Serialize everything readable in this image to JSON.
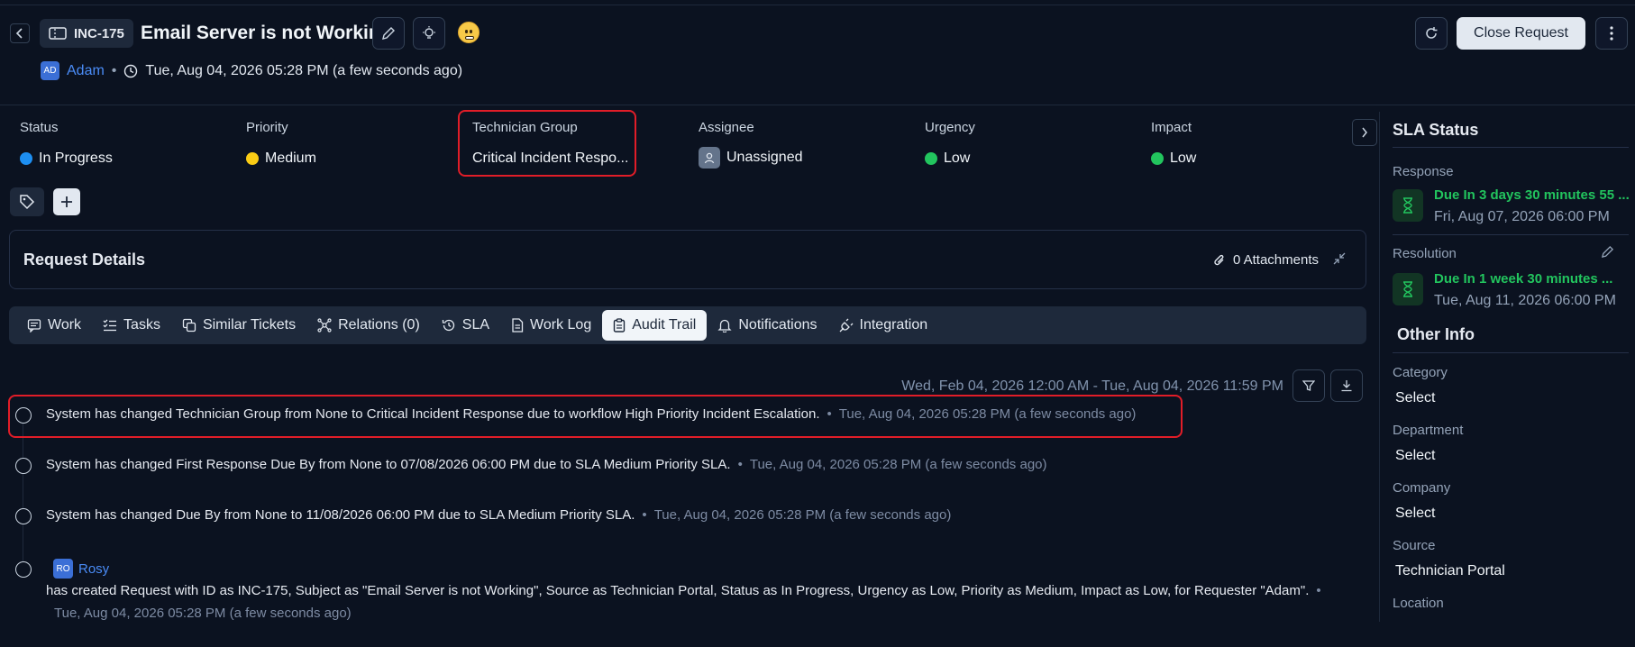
{
  "header": {
    "ticket_id": "INC-175",
    "title": "Email Server is not Working",
    "requester_initials": "AD",
    "requester": "Adam",
    "created": "Tue, Aug 04, 2026 05:28 PM (a few seconds ago)",
    "close_button": "Close Request"
  },
  "fields": {
    "status": {
      "label": "Status",
      "value": "In Progress",
      "color": "#1d8ff2"
    },
    "priority": {
      "label": "Priority",
      "value": "Medium",
      "color": "#facc15"
    },
    "technician_group": {
      "label": "Technician Group",
      "value": "Critical Incident Respo..."
    },
    "assignee": {
      "label": "Assignee",
      "value": "Unassigned"
    },
    "urgency": {
      "label": "Urgency",
      "value": "Low",
      "color": "#22c55e"
    },
    "impact": {
      "label": "Impact",
      "value": "Low",
      "color": "#22c55e"
    }
  },
  "request_details": {
    "title": "Request Details",
    "attachments": "0 Attachments"
  },
  "tabs": [
    {
      "label": "Work",
      "icon": "message-icon"
    },
    {
      "label": "Tasks",
      "icon": "checklist-icon"
    },
    {
      "label": "Similar Tickets",
      "icon": "copy-icon"
    },
    {
      "label": "Relations (0)",
      "icon": "network-icon"
    },
    {
      "label": "SLA",
      "icon": "history-icon"
    },
    {
      "label": "Work Log",
      "icon": "document-icon"
    },
    {
      "label": "Audit Trail",
      "icon": "clipboard-icon",
      "active": true
    },
    {
      "label": "Notifications",
      "icon": "bell-icon"
    },
    {
      "label": "Integration",
      "icon": "plug-icon"
    }
  ],
  "audit": {
    "date_range": "Wed, Feb 04, 2026 12:00 AM - Tue, Aug 04, 2026 11:59 PM",
    "entries": [
      {
        "text": "System has changed Technician Group from None to Critical Incident Response due to workflow High Priority Incident Escalation.",
        "time": "Tue, Aug 04, 2026 05:28 PM (a few seconds ago)"
      },
      {
        "text": "System has changed First Response Due By from None to 07/08/2026 06:00 PM due to SLA Medium Priority SLA.",
        "time": "Tue, Aug 04, 2026 05:28 PM (a few seconds ago)"
      },
      {
        "text": "System has changed Due By from None to 11/08/2026 06:00 PM due to SLA Medium Priority SLA.",
        "time": "Tue, Aug 04, 2026 05:28 PM (a few seconds ago)"
      },
      {
        "user_initials": "RO",
        "user": "Rosy",
        "text": "has created Request with ID as INC-175, Subject as \"Email Server is not Working\", Source as Technician Portal, Status as In Progress, Urgency as Low, Priority as Medium, Impact as Low, for Requester \"Adam\".",
        "time": "Tue, Aug 04, 2026 05:28 PM (a few seconds ago)"
      }
    ]
  },
  "sidebar": {
    "sla_title": "SLA Status",
    "response": {
      "label": "Response",
      "due": "Due In 3 days 30 minutes 55 ...",
      "date": "Fri, Aug 07, 2026 06:00 PM"
    },
    "resolution": {
      "label": "Resolution",
      "due": "Due In 1 week 30 minutes ...",
      "date": "Tue, Aug 11, 2026 06:00 PM"
    },
    "other_title": "Other Info",
    "category": {
      "label": "Category",
      "value": "Select"
    },
    "department": {
      "label": "Department",
      "value": "Select"
    },
    "company": {
      "label": "Company",
      "value": "Select"
    },
    "source": {
      "label": "Source",
      "value": "Technician Portal"
    },
    "location": {
      "label": "Location"
    }
  },
  "colors": {
    "background": "#0b1220",
    "panel": "#1e293b",
    "accent_link": "#4a8cf7",
    "highlight_red": "#e11d28",
    "sla_green": "#22c55e"
  }
}
